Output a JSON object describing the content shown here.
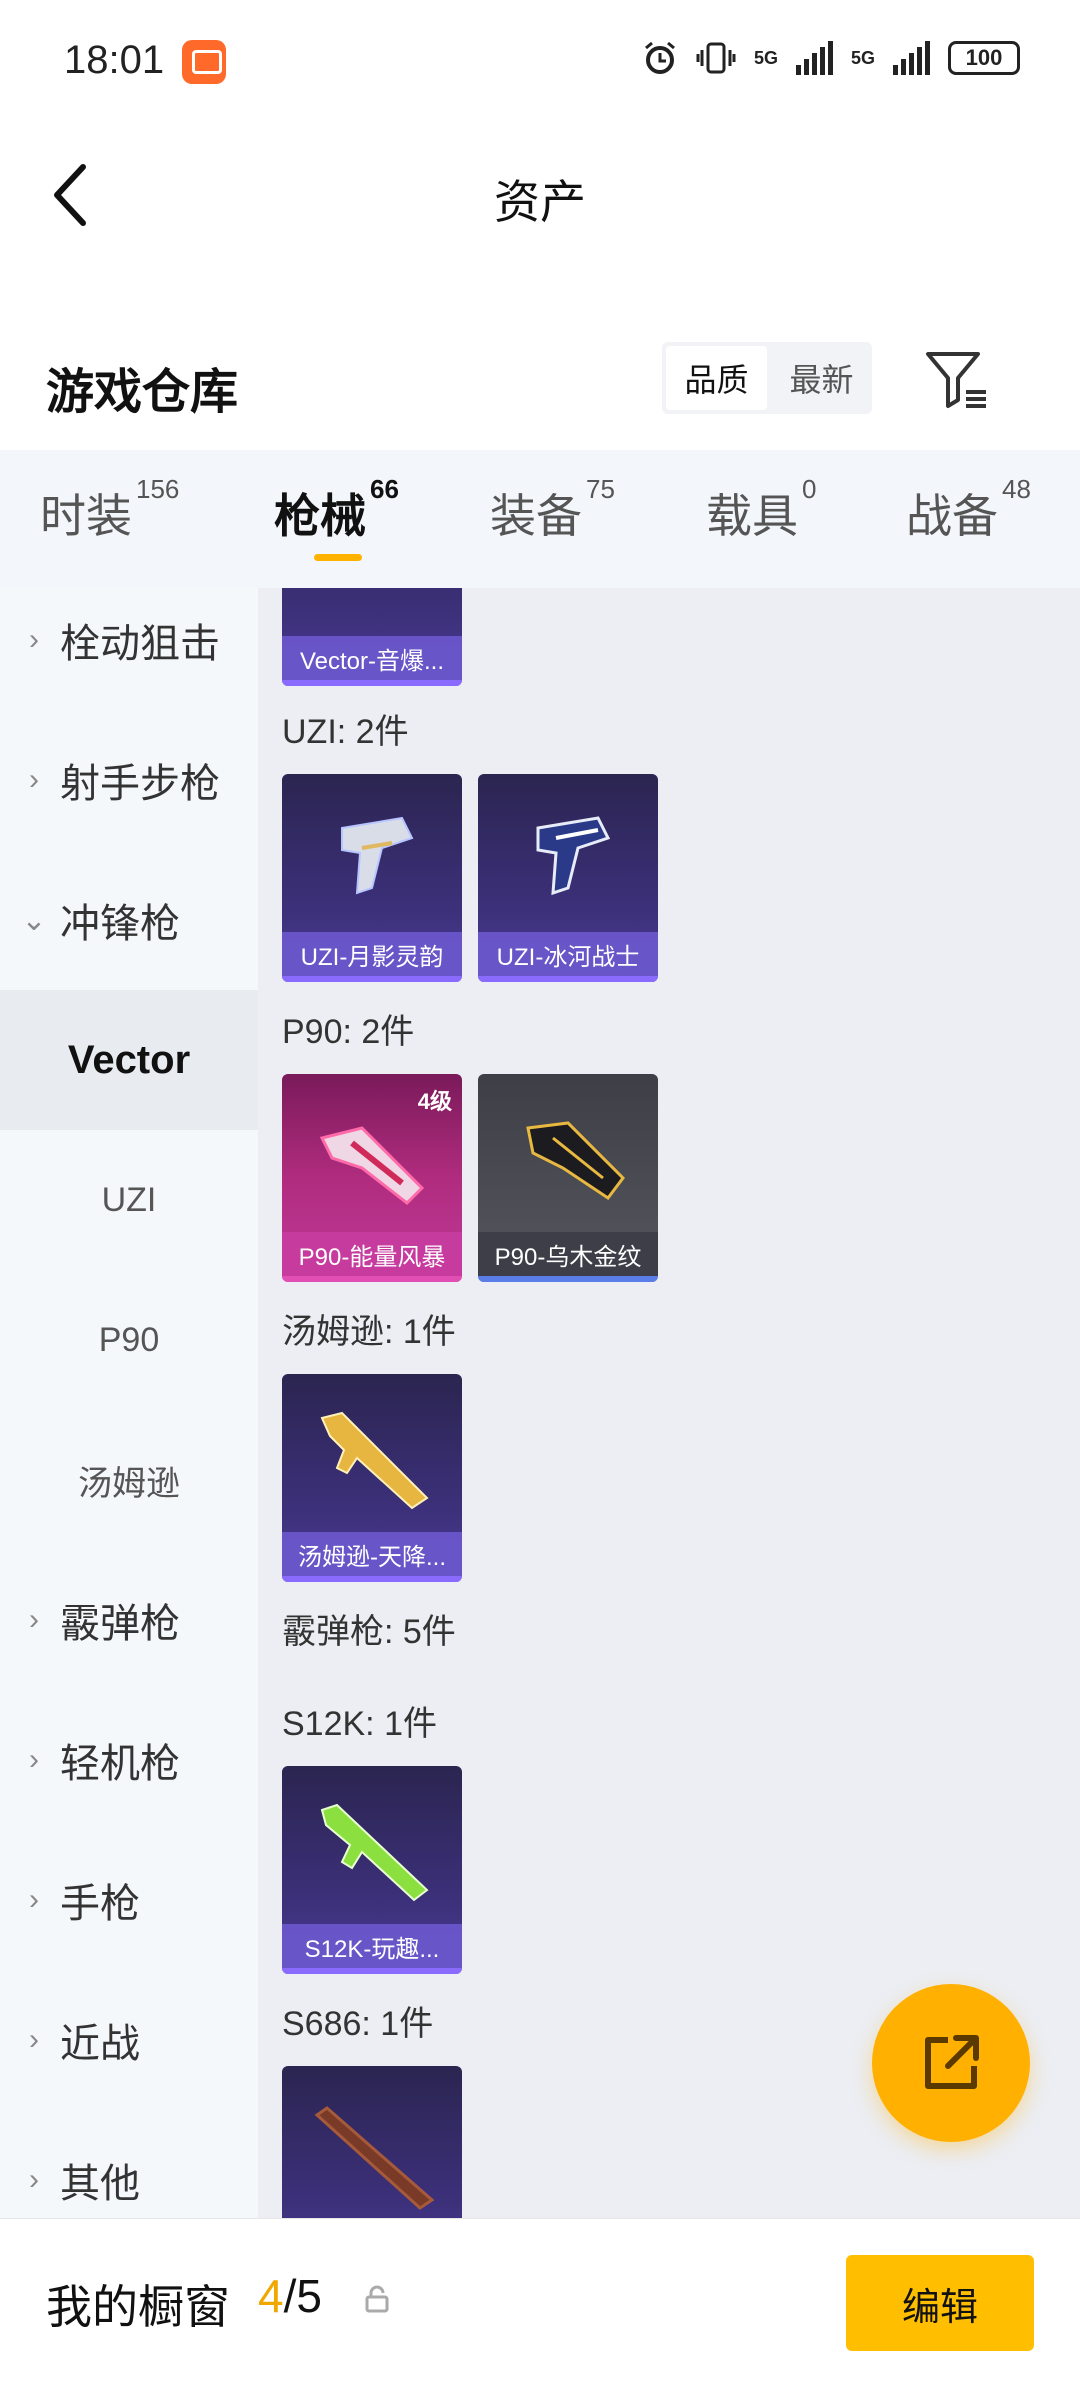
{
  "status_bar": {
    "time": "18:01",
    "net1": "5G",
    "net2": "5G",
    "battery": "100"
  },
  "header": {
    "title": "资产"
  },
  "warehouse": {
    "title": "游戏仓库",
    "sort_quality": "品质",
    "sort_newest": "最新"
  },
  "tabs": [
    {
      "label": "时装",
      "count": "156"
    },
    {
      "label": "枪械",
      "count": "66"
    },
    {
      "label": "装备",
      "count": "75"
    },
    {
      "label": "载具",
      "count": "0"
    },
    {
      "label": "战备",
      "count": "48"
    }
  ],
  "sidebar": {
    "items": [
      {
        "label": "栓动狙击"
      },
      {
        "label": "射手步枪"
      },
      {
        "label": "冲锋枪"
      },
      {
        "label": "Vector"
      },
      {
        "label": "UZI"
      },
      {
        "label": "P90"
      },
      {
        "label": "汤姆逊"
      },
      {
        "label": "霰弹枪"
      },
      {
        "label": "轻机枪"
      },
      {
        "label": "手枪"
      },
      {
        "label": "近战"
      },
      {
        "label": "其他"
      }
    ]
  },
  "content": {
    "vector_card": "Vector-音爆...",
    "uzi_label": "UZI: 2件",
    "uzi_cards": [
      "UZI-月影灵韵",
      "UZI-冰河战士"
    ],
    "p90_label": "P90: 2件",
    "p90_cards": [
      "P90-能量风暴",
      "P90-乌木金纹"
    ],
    "p90_level": "4级",
    "thompson_label": "汤姆逊: 1件",
    "thompson_card": "汤姆逊-天降...",
    "shotgun_label": "霰弹枪: 5件",
    "s12k_label": "S12K: 1件",
    "s12k_card": "S12K-玩趣...",
    "s686_label": "S686: 1件"
  },
  "bottom_bar": {
    "title": "我的橱窗",
    "current": "4",
    "total": "/5",
    "edit_label": "编辑"
  },
  "colors": {
    "accent": "#ffbf00",
    "tab_underline": "#ffb300",
    "sidebar_bg": "#f5f8fb",
    "content_bg": "#eceef3"
  }
}
